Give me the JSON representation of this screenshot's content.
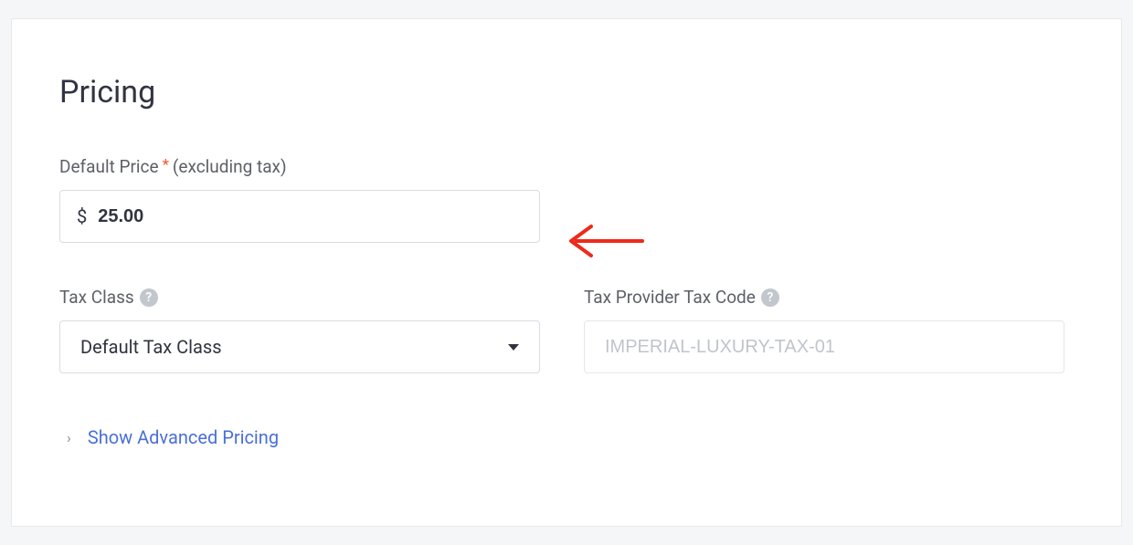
{
  "heading": "Pricing",
  "defaultPrice": {
    "label": "Default Price",
    "requiredMark": "*",
    "suffix": "(excluding tax)",
    "currency": "$",
    "value": "25.00"
  },
  "taxClass": {
    "label": "Tax Class",
    "helpGlyph": "?",
    "selected": "Default Tax Class"
  },
  "taxProviderCode": {
    "label": "Tax Provider Tax Code",
    "helpGlyph": "?",
    "placeholder": "IMPERIAL-LUXURY-TAX-01",
    "value": ""
  },
  "advancedPricing": {
    "chevron": "›",
    "label": "Show Advanced Pricing"
  },
  "annotation": {
    "color": "#ed2a1b"
  }
}
